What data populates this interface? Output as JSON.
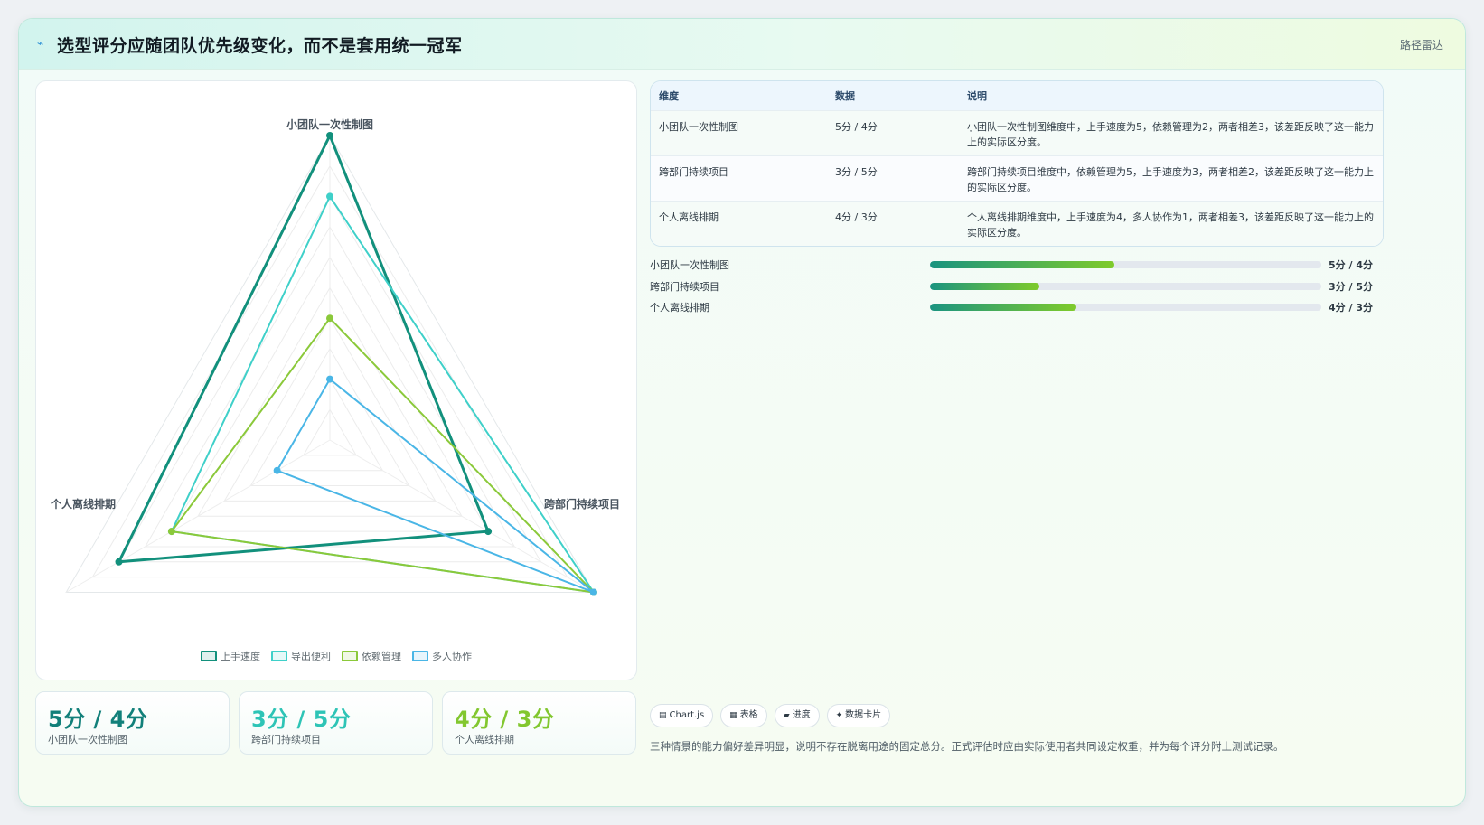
{
  "header": {
    "logo_icon": "route-icon",
    "title": "选型评分应随团队优先级变化，而不是套用统一冠军",
    "tag": "路径雷达"
  },
  "chart_data": {
    "type": "radar",
    "axes": [
      "小团队一次性制图",
      "跨部门持续项目",
      "个人离线排期"
    ],
    "rmax": 5,
    "rings": 10,
    "series": [
      {
        "name": "上手速度",
        "values": [
          5,
          3,
          4
        ],
        "color": "#12907c"
      },
      {
        "name": "导出便利",
        "values": [
          4,
          5,
          3
        ],
        "color": "#3fd0c9"
      },
      {
        "name": "依赖管理",
        "values": [
          2,
          5,
          3
        ],
        "color": "#8bc93a"
      },
      {
        "name": "多人协作",
        "values": [
          1,
          5,
          1
        ],
        "color": "#4ab6e6"
      }
    ]
  },
  "kpis": [
    {
      "value": "5分 / 4分",
      "label": "小团队一次性制图",
      "color": "#12807a"
    },
    {
      "value": "3分 / 5分",
      "label": "跨部门持续项目",
      "color": "#2ec4b6"
    },
    {
      "value": "4分 / 3分",
      "label": "个人离线排期",
      "color": "#82c72f"
    }
  ],
  "table": {
    "headers": [
      "维度",
      "数据",
      "说明"
    ],
    "rows": [
      {
        "dim": "小团队一次性制图",
        "data": "5分 / 4分",
        "desc": "小团队一次性制图维度中，上手速度为5，依赖管理为2，两者相差3，该差距反映了这一能力上的实际区分度。"
      },
      {
        "dim": "跨部门持续项目",
        "data": "3分 / 5分",
        "desc": "跨部门持续项目维度中，依赖管理为5，上手速度为3，两者相差2，该差距反映了这一能力上的实际区分度。"
      },
      {
        "dim": "个人离线排期",
        "data": "4分 / 3分",
        "desc": "个人离线排期维度中，上手速度为4，多人协作为1，两者相差3，该差距反映了这一能力上的实际区分度。"
      }
    ]
  },
  "progress": [
    {
      "label": "小团队一次性制图",
      "value": "5分 / 4分",
      "fraction": 0.47
    },
    {
      "label": "跨部门持续项目",
      "value": "3分 / 5分",
      "fraction": 0.28
    },
    {
      "label": "个人离线排期",
      "value": "4分 / 3分",
      "fraction": 0.375
    }
  ],
  "chips": [
    {
      "icon": "chart-icon",
      "glyph": "▤",
      "label": "Chart.js"
    },
    {
      "icon": "table-icon",
      "glyph": "▦",
      "label": "表格"
    },
    {
      "icon": "progress-icon",
      "glyph": "▰",
      "label": "进度"
    },
    {
      "icon": "card-icon",
      "glyph": "✦",
      "label": "数据卡片"
    }
  ],
  "footnote": "三种情景的能力偏好差异明显，说明不存在脱离用途的固定总分。正式评估时应由实际使用者共同设定权重，并为每个评分附上测试记录。"
}
